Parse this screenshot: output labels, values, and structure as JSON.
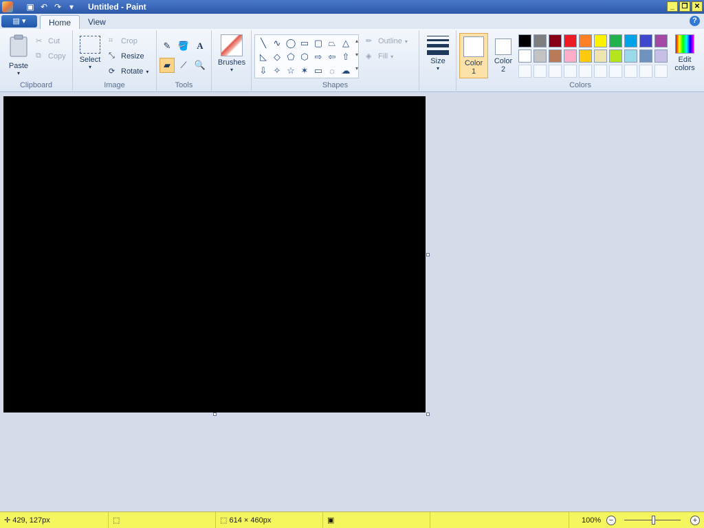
{
  "window": {
    "title": "Untitled - Paint",
    "buttons": {
      "minimize": "_",
      "restore": "❐",
      "close": "✕"
    }
  },
  "tabs": {
    "home": "Home",
    "view": "View"
  },
  "clipboard": {
    "paste": "Paste",
    "cut": "Cut",
    "copy": "Copy",
    "label": "Clipboard"
  },
  "image": {
    "select": "Select",
    "crop": "Crop",
    "resize": "Resize",
    "rotate": "Rotate",
    "label": "Image"
  },
  "tools": {
    "label": "Tools",
    "icons": [
      "pencil-icon",
      "fill-icon",
      "text-icon",
      "eraser-icon",
      "color-picker-icon",
      "magnifier-icon"
    ],
    "active": "eraser-icon"
  },
  "brushes": {
    "label": "Brushes"
  },
  "shapes": {
    "label": "Shapes",
    "outline": "Outline",
    "fill": "Fill",
    "glyphs": [
      "╲",
      "∿",
      "◯",
      "▭",
      "▢",
      "⏢",
      "△",
      "◺",
      "◇",
      "⬠",
      "⬡",
      "⇨",
      "⇦",
      "⇧",
      "⇩",
      "✧",
      "☆",
      "✶",
      "▭",
      "◌",
      "☁"
    ]
  },
  "size": {
    "label": "Size"
  },
  "colors": {
    "label": "Colors",
    "color1_label": "Color 1",
    "color2_label": "Color 2",
    "color1": "#ffffff",
    "color2": "#ffffff",
    "edit_colors": "Edit colors",
    "palette": [
      "#000000",
      "#7f7f7f",
      "#880015",
      "#ed1c24",
      "#ff7f27",
      "#fff200",
      "#22b14c",
      "#00a2e8",
      "#3f48cc",
      "#a349a4",
      "#ffffff",
      "#c3c3c3",
      "#b97a57",
      "#ffaec9",
      "#ffc90e",
      "#efe4b0",
      "#b5e61d",
      "#99d9ea",
      "#7092be",
      "#c8bfe7"
    ]
  },
  "canvas": {
    "background": "#000000"
  },
  "status": {
    "cursor": "429, 127px",
    "size": "614 × 460px",
    "zoom": "100%"
  }
}
